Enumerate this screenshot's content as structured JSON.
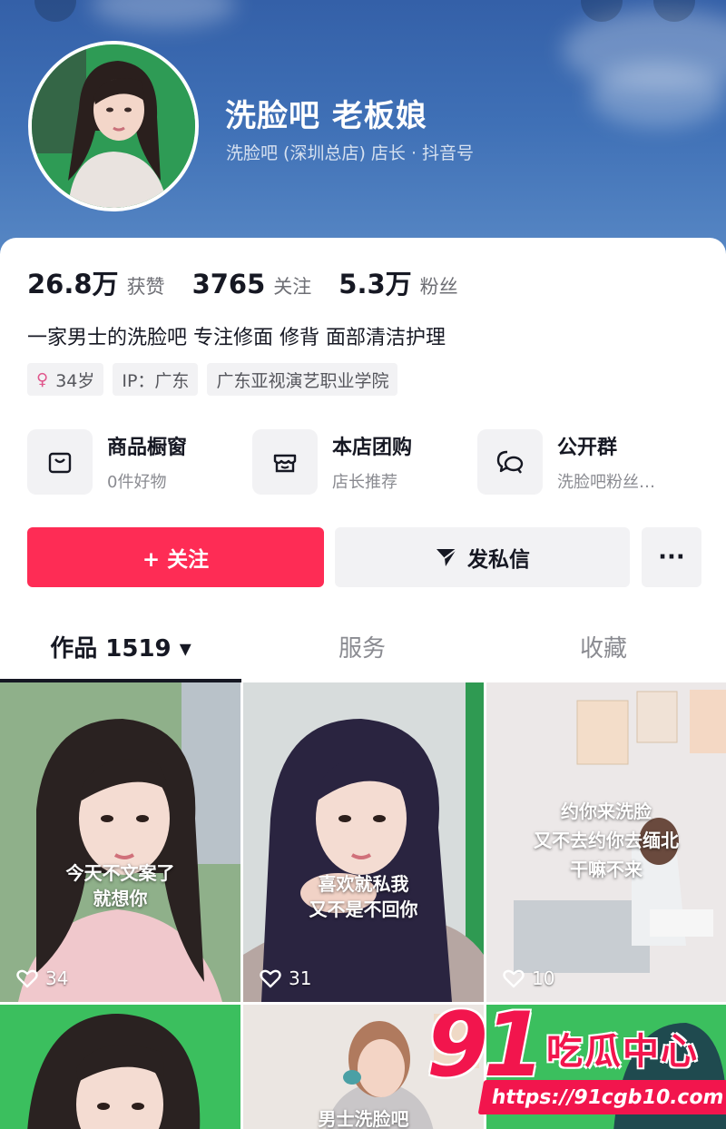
{
  "profile": {
    "name": "洗脸吧 老板娘",
    "subtitle": "洗脸吧 (深圳总店) 店长 · 抖音号"
  },
  "stats": [
    {
      "value": "26.8万",
      "label": "获赞"
    },
    {
      "value": "3765",
      "label": "关注"
    },
    {
      "value": "5.3万",
      "label": "粉丝"
    }
  ],
  "bio": "一家男士的洗脸吧 专注修面 修背 面部清洁护理",
  "tags": {
    "gender_symbol": "♀",
    "age": "34岁",
    "location": "IP：广东",
    "school": "广东亚视演艺职业学院"
  },
  "features": [
    {
      "title": "商品橱窗",
      "sub": "0件好物",
      "icon": "shopping-bag-icon"
    },
    {
      "title": "本店团购",
      "sub": "店长推荐",
      "icon": "store-icon"
    },
    {
      "title": "公开群",
      "sub": "洗脸吧粉丝…",
      "icon": "chat-bubbles-icon"
    }
  ],
  "actions": {
    "follow": "+ 关注",
    "message": "发私信",
    "more": "···"
  },
  "tabs": {
    "works": "作品 1519 ▾",
    "services": "服务",
    "favorites": "收藏"
  },
  "videos": [
    {
      "caption_1": "今天不文案了",
      "caption_2": "就想你",
      "likes": "34"
    },
    {
      "caption_1": "喜欢就私我",
      "caption_2": "又不是不回你",
      "likes": "31"
    },
    {
      "caption_1": "约你来洗脸",
      "caption_2": "又不去约你去缅北",
      "caption_3": "干嘛不来",
      "likes": "10"
    },
    {
      "caption_1": "",
      "likes": ""
    },
    {
      "caption_1": "男士洗脸吧",
      "likes": ""
    },
    {
      "caption_1": "",
      "likes": ""
    }
  ],
  "watermark": {
    "brand": "91",
    "text": "吃瓜中心",
    "url": "https://91cgb10.com"
  },
  "colors": {
    "accent": "#fe2c55",
    "header_blue": "#3f70b6",
    "watermark_red": "#f2154d"
  }
}
